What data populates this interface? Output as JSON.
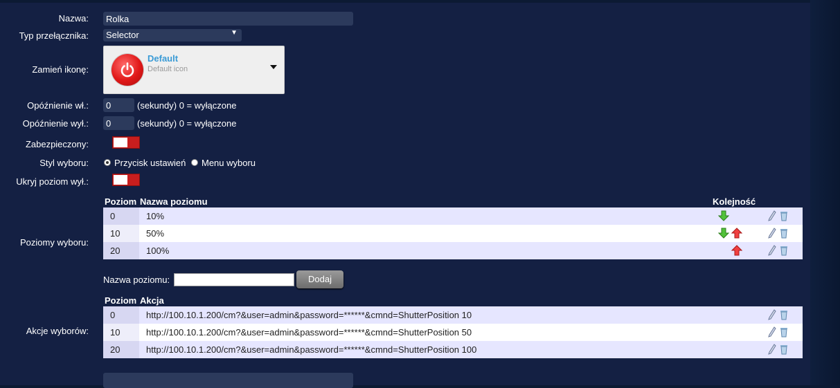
{
  "form": {
    "name_label": "Nazwa:",
    "name_value": "Rolka",
    "type_label": "Typ przełącznika:",
    "type_value": "Selector",
    "icon_label": "Zamień ikonę:",
    "icon_title": "Default",
    "icon_subtitle": "Default icon",
    "on_delay_label": "Opóźnienie wł.:",
    "on_delay_value": "0",
    "on_delay_hint": "(sekundy) 0 = wyłączone",
    "off_delay_label": "Opóźnienie wył.:",
    "off_delay_value": "0",
    "off_delay_hint": "(sekundy) 0 = wyłączone",
    "protected_label": "Zabezpieczony:",
    "style_label": "Styl wyboru:",
    "style_option_buttons": "Przycisk ustawień",
    "style_option_menu": "Menu wyboru",
    "hide_off_label": "Ukryj poziom wył.:"
  },
  "levels": {
    "label": "Poziomy wyboru:",
    "col_level": "Poziom",
    "col_name": "Nazwa poziomu",
    "col_order": "Kolejność",
    "rows": [
      {
        "level": "0",
        "name": "10%"
      },
      {
        "level": "10",
        "name": "50%"
      },
      {
        "level": "20",
        "name": "100%"
      }
    ],
    "new_label": "Nazwa poziomu:",
    "new_value": "",
    "add_button": "Dodaj"
  },
  "actions": {
    "label": "Akcje wyborów:",
    "col_level": "Poziom",
    "col_action": "Akcja",
    "rows": [
      {
        "level": "0",
        "action": "http://100.10.1.200/cm?&user=admin&password=******&cmnd=ShutterPosition 10"
      },
      {
        "level": "10",
        "action": "http://100.10.1.200/cm?&user=admin&password=******&cmnd=ShutterPosition 50"
      },
      {
        "level": "20",
        "action": "http://100.10.1.200/cm?&user=admin&password=******&cmnd=ShutterPosition 100"
      }
    ]
  },
  "colors": {
    "background": "#142043",
    "toggle_off": "#c81e1e",
    "row_odd": "#e6e6ff",
    "icon_title": "#3a9bd6"
  },
  "icons": [
    "power-icon",
    "arrow-down-icon",
    "arrow-up-icon",
    "edit-pencil-icon",
    "trash-icon"
  ]
}
